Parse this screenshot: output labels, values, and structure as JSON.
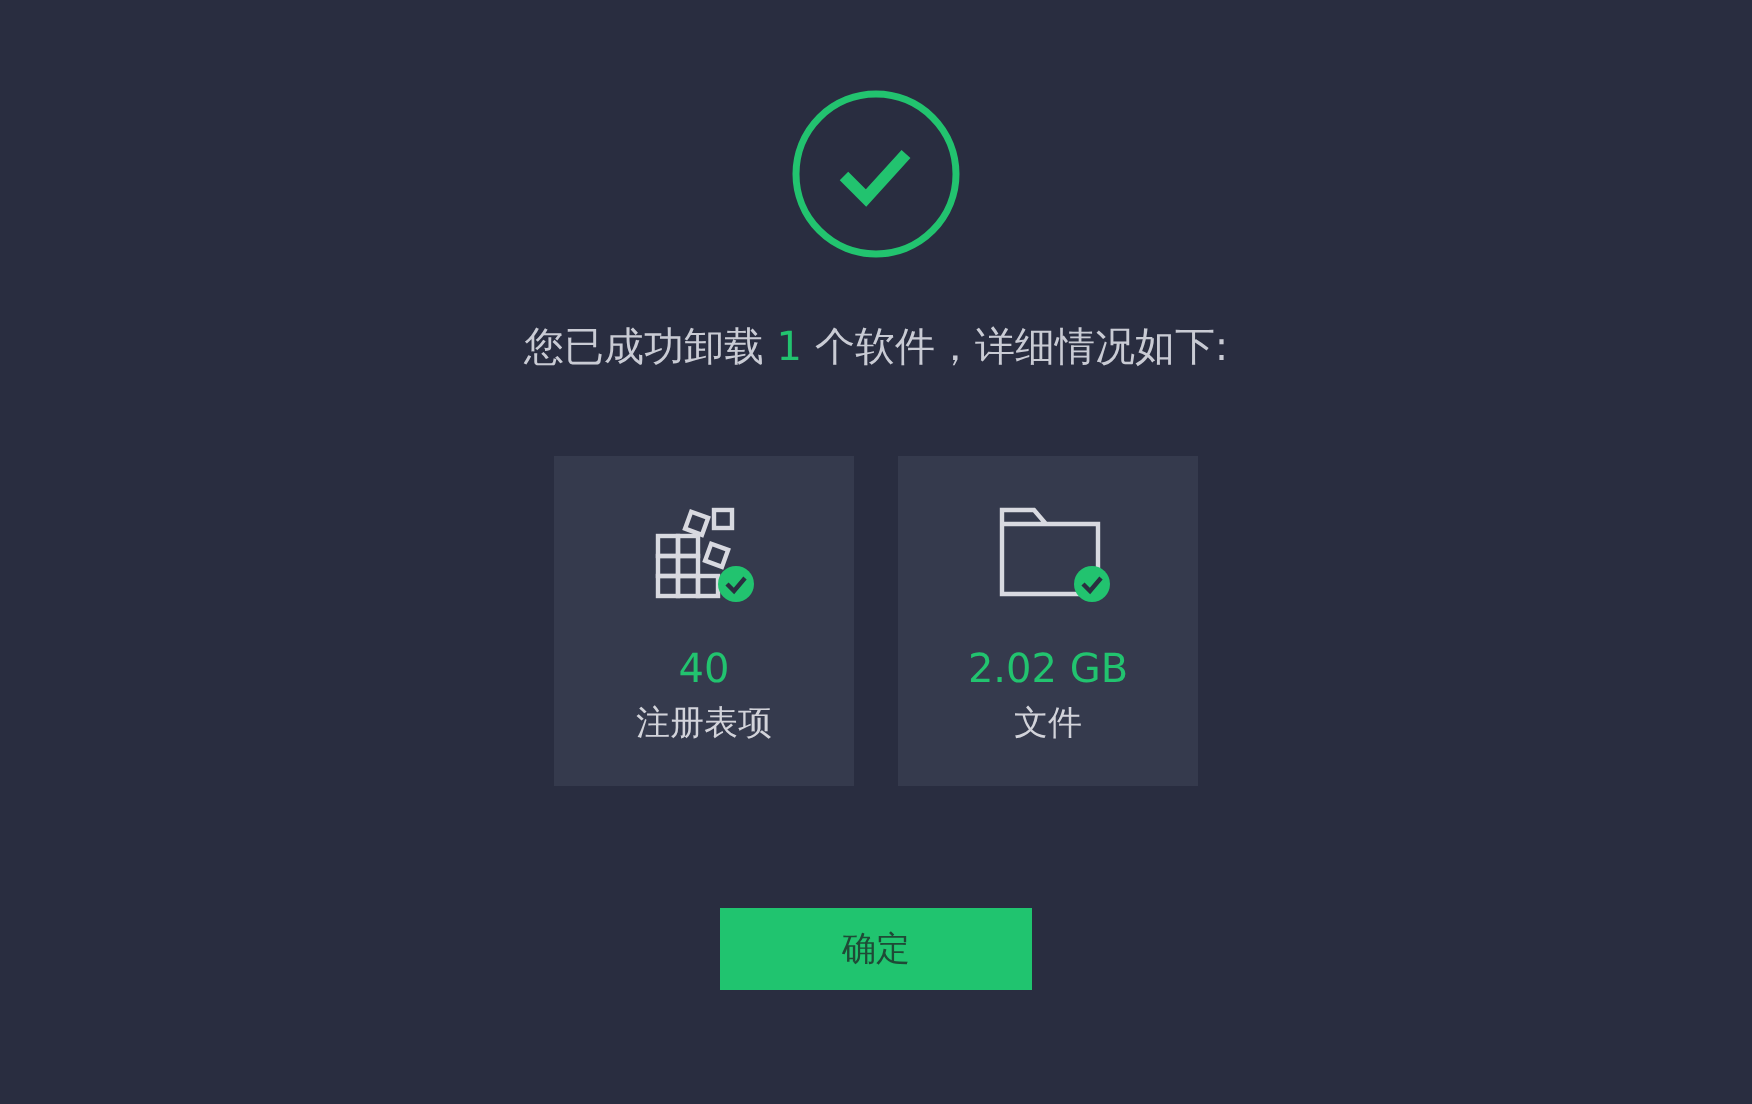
{
  "status": {
    "kind": "success"
  },
  "message": {
    "before": "您已成功卸载 ",
    "count": "1",
    "after": " 个软件，详细情况如下:"
  },
  "stats": [
    {
      "kind": "registry",
      "value": "40",
      "label": "注册表项",
      "done": true
    },
    {
      "kind": "files",
      "value": "2.02 GB",
      "label": "文件",
      "done": true
    }
  ],
  "confirm_button": "确定"
}
